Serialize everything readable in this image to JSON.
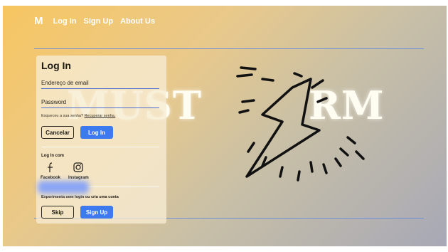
{
  "nav": {
    "logo": "M",
    "login": "Log In",
    "signup": "Sign Up",
    "about": "About Us"
  },
  "brand": {
    "left": "MUST",
    "right": "RM"
  },
  "login": {
    "title": "Log In",
    "email_label": "Endereço de email",
    "password_label": "Password",
    "forgot_text": "Esqueceu a sua senha?",
    "forgot_link": "Recuperar senha.",
    "cancel": "Cancelar",
    "login_btn": "Log In",
    "login_with": "Log In com",
    "facebook": "Facebook",
    "instagram": "Instagram",
    "guest_text": "Experimenta sem login ou cria uma conta",
    "skip": "Skip",
    "signup": "Sign Up"
  },
  "icons": {
    "facebook": "facebook-icon",
    "instagram": "instagram-icon",
    "logo": "lightning-logo"
  },
  "colors": {
    "accent": "#3d7af0",
    "line": "#6f8fd6"
  }
}
